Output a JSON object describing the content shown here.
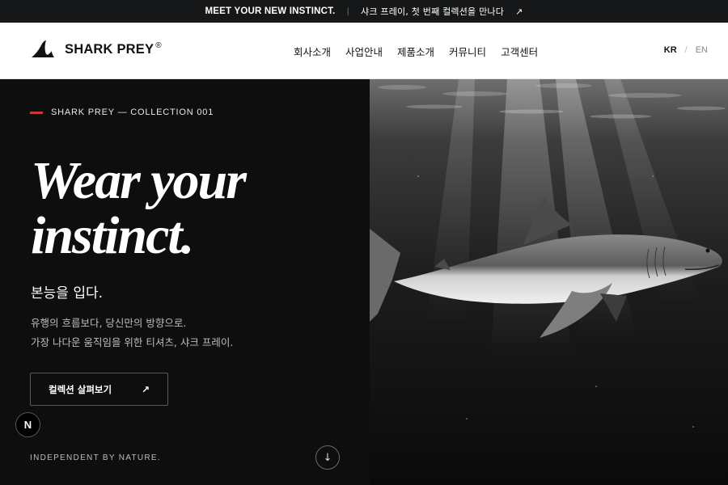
{
  "topbar": {
    "en": "MEET YOUR NEW INSTINCT.",
    "separator": "|",
    "ko": "샤크 프레이, 첫 번째 컬렉션을 만나다",
    "arrow": "↗"
  },
  "header": {
    "brand": "SHARK PREY",
    "brand_mark": "®",
    "nav": [
      "회사소개",
      "사업안내",
      "제품소개",
      "커뮤니티",
      "고객센터"
    ],
    "lang": {
      "kr": "KR",
      "slash": "/",
      "en": "EN"
    }
  },
  "hero": {
    "eyebrow": "SHARK PREY — COLLECTION 001",
    "accent": "#c23b3b",
    "headline": [
      "Wear your",
      "instinct."
    ],
    "subhead": "본능을 입다.",
    "desc": [
      "유행의 흐름보다, 당신만의 방향으로.",
      "가장 나다운 움직임을 위한 티셔츠, 샤크 프레이."
    ],
    "cta_label": "컬렉션 살펴보기",
    "cta_arrow": "↗",
    "badge": "N",
    "tagline": "INDEPENDENT BY NATURE.",
    "scroll_icon": "↓"
  }
}
